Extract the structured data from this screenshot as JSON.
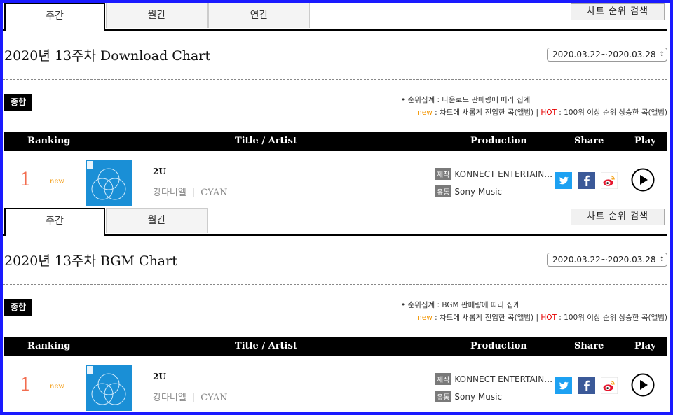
{
  "sections": [
    {
      "tabs": [
        "주간",
        "월간",
        "연간"
      ],
      "search_label": "차트 순위 검색",
      "title": "2020년 13주차 Download Chart",
      "date_range": "2020.03.22~2020.03.28",
      "badge": "종합",
      "note_line1": "순위집계 : 다운로드 판매량에 따라 집계",
      "note_new": "new",
      "note_new_text": " : 차트에 새롭게 진입한 곡(앨범) | ",
      "note_hot": "HOT",
      "note_hot_text": " : 100위 이상 순위 상승한 곡(앨범)",
      "columns": [
        "Ranking",
        "Title / Artist",
        "Production",
        "Share",
        "Play"
      ],
      "row": {
        "rank": "1",
        "status": "new",
        "title": "2U",
        "artists": [
          "강다니엘",
          "CYAN"
        ],
        "production_label": "제작",
        "production": "KONNECT ENTERTAIN…",
        "distribution_label": "유통",
        "distribution": "Sony Music"
      }
    },
    {
      "tabs": [
        "주간",
        "월간"
      ],
      "search_label": "차트 순위 검색",
      "title": "2020년 13주차 BGM Chart",
      "date_range": "2020.03.22~2020.03.28",
      "badge": "종합",
      "note_line1": "순위집계 : BGM 판매량에 따라 집계",
      "note_new": "new",
      "note_new_text": " : 차트에 새롭게 진입한 곡(앨범) | ",
      "note_hot": "HOT",
      "note_hot_text": " : 100위 이상 순위 상승한 곡(앨범)",
      "columns": [
        "Ranking",
        "Title / Artist",
        "Production",
        "Share",
        "Play"
      ],
      "row": {
        "rank": "1",
        "status": "new",
        "title": "2U",
        "artists": [
          "강다니엘",
          "CYAN"
        ],
        "production_label": "제작",
        "production": "KONNECT ENTERTAIN…",
        "distribution_label": "유통",
        "distribution": "Sony Music"
      }
    }
  ],
  "icons": {
    "share": [
      "twitter-icon",
      "facebook-icon",
      "weibo-icon"
    ],
    "play": "play-icon",
    "select_arrow": "updown-arrow-icon"
  },
  "colors": {
    "rank": "#f26d4f",
    "new": "#f29400",
    "hot": "#e60000",
    "twitter": "#1da1f2",
    "facebook": "#3b5998",
    "cover": "#1a8fd6",
    "frame": "#1a1aff"
  }
}
